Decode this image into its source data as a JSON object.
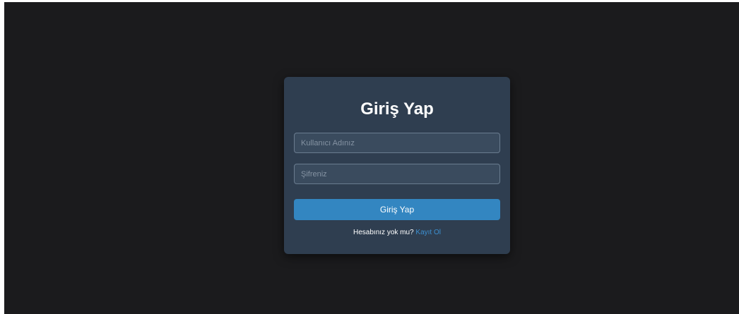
{
  "login": {
    "title": "Giriş Yap",
    "username_placeholder": "Kullanıcı Adınız",
    "password_placeholder": "Şifreniz",
    "submit_label": "Giriş Yap",
    "register_prompt": "Hesabınız yok mu?",
    "register_link": "Kayıt Ol"
  },
  "colors": {
    "page_background": "#1b1b1d",
    "card_background": "#2f3e50",
    "button_primary": "#3386c1",
    "link": "#3c8fd0"
  }
}
